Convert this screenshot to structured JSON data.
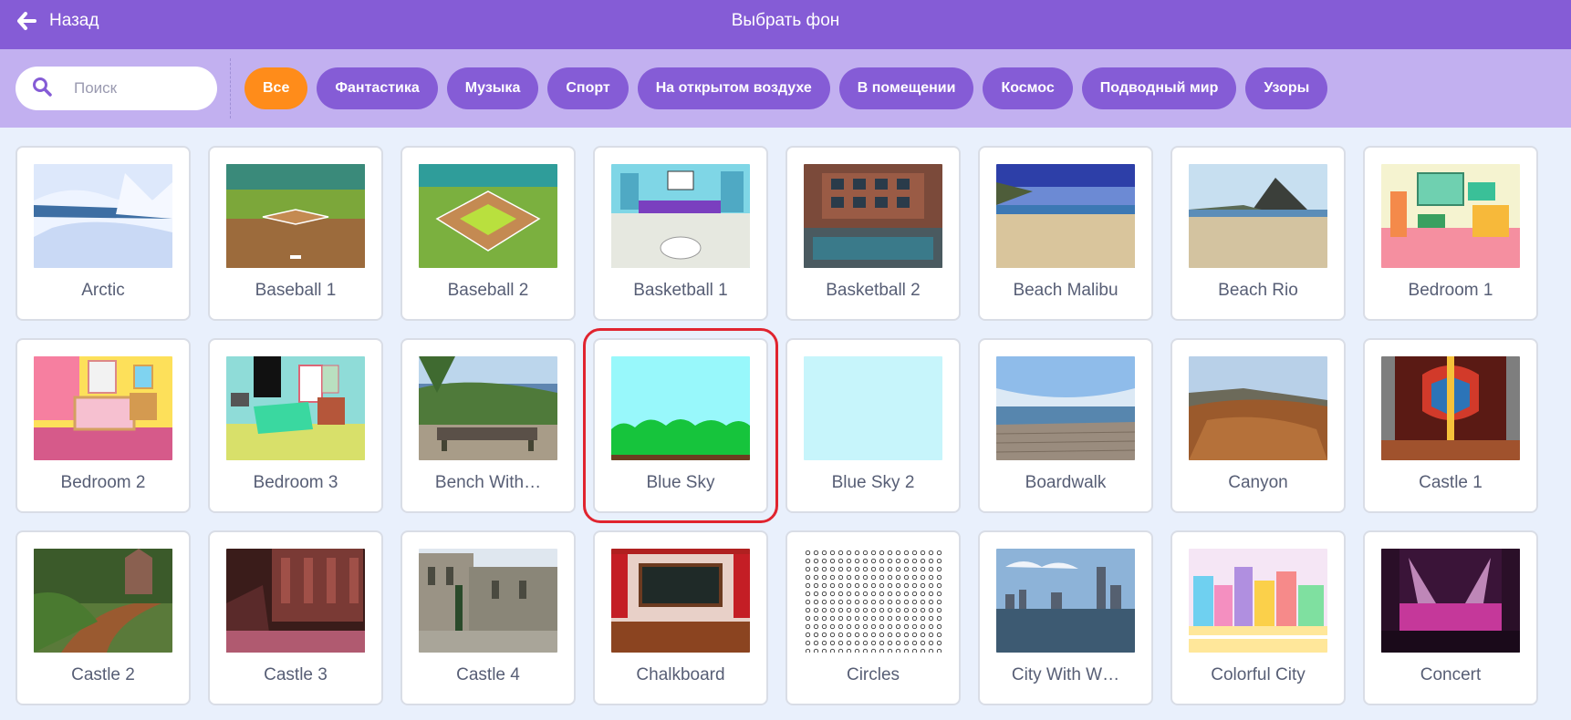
{
  "header": {
    "back_label": "Назад",
    "title": "Выбрать фон"
  },
  "search": {
    "placeholder": "Поиск"
  },
  "tags": [
    {
      "label": "Все",
      "active": true
    },
    {
      "label": "Фантастика",
      "active": false
    },
    {
      "label": "Музыка",
      "active": false
    },
    {
      "label": "Спорт",
      "active": false
    },
    {
      "label": "На открытом воздухе",
      "active": false
    },
    {
      "label": "В помещении",
      "active": false
    },
    {
      "label": "Космос",
      "active": false
    },
    {
      "label": "Подводный мир",
      "active": false
    },
    {
      "label": "Узоры",
      "active": false
    }
  ],
  "backdrops": [
    {
      "name": "Arctic",
      "thumb": "arctic"
    },
    {
      "name": "Baseball 1",
      "thumb": "baseball1"
    },
    {
      "name": "Baseball 2",
      "thumb": "baseball2"
    },
    {
      "name": "Basketball 1",
      "thumb": "basketball1"
    },
    {
      "name": "Basketball 2",
      "thumb": "basketball2"
    },
    {
      "name": "Beach Malibu",
      "thumb": "beach-malibu"
    },
    {
      "name": "Beach Rio",
      "thumb": "beach-rio"
    },
    {
      "name": "Bedroom 1",
      "thumb": "bedroom1"
    },
    {
      "name": "Bedroom 2",
      "thumb": "bedroom2"
    },
    {
      "name": "Bedroom 3",
      "thumb": "bedroom3"
    },
    {
      "name": "Bench With…",
      "thumb": "bench"
    },
    {
      "name": "Blue Sky",
      "thumb": "blue-sky",
      "selected": true
    },
    {
      "name": "Blue Sky 2",
      "thumb": "blue-sky-2"
    },
    {
      "name": "Boardwalk",
      "thumb": "boardwalk"
    },
    {
      "name": "Canyon",
      "thumb": "canyon"
    },
    {
      "name": "Castle 1",
      "thumb": "castle1"
    },
    {
      "name": "Castle 2",
      "thumb": "castle2"
    },
    {
      "name": "Castle 3",
      "thumb": "castle3"
    },
    {
      "name": "Castle 4",
      "thumb": "castle4"
    },
    {
      "name": "Chalkboard",
      "thumb": "chalkboard"
    },
    {
      "name": "Circles",
      "thumb": "circles"
    },
    {
      "name": "City With W…",
      "thumb": "city"
    },
    {
      "name": "Colorful City",
      "thumb": "colorful-city"
    },
    {
      "name": "Concert",
      "thumb": "concert"
    }
  ],
  "colors": {
    "header": "#855cd6",
    "filterbar": "#c2b0f0",
    "tag": "#855cd6",
    "tag_active": "#ff8c1a",
    "selection": "#e0242f",
    "background": "#e9f0fc"
  }
}
